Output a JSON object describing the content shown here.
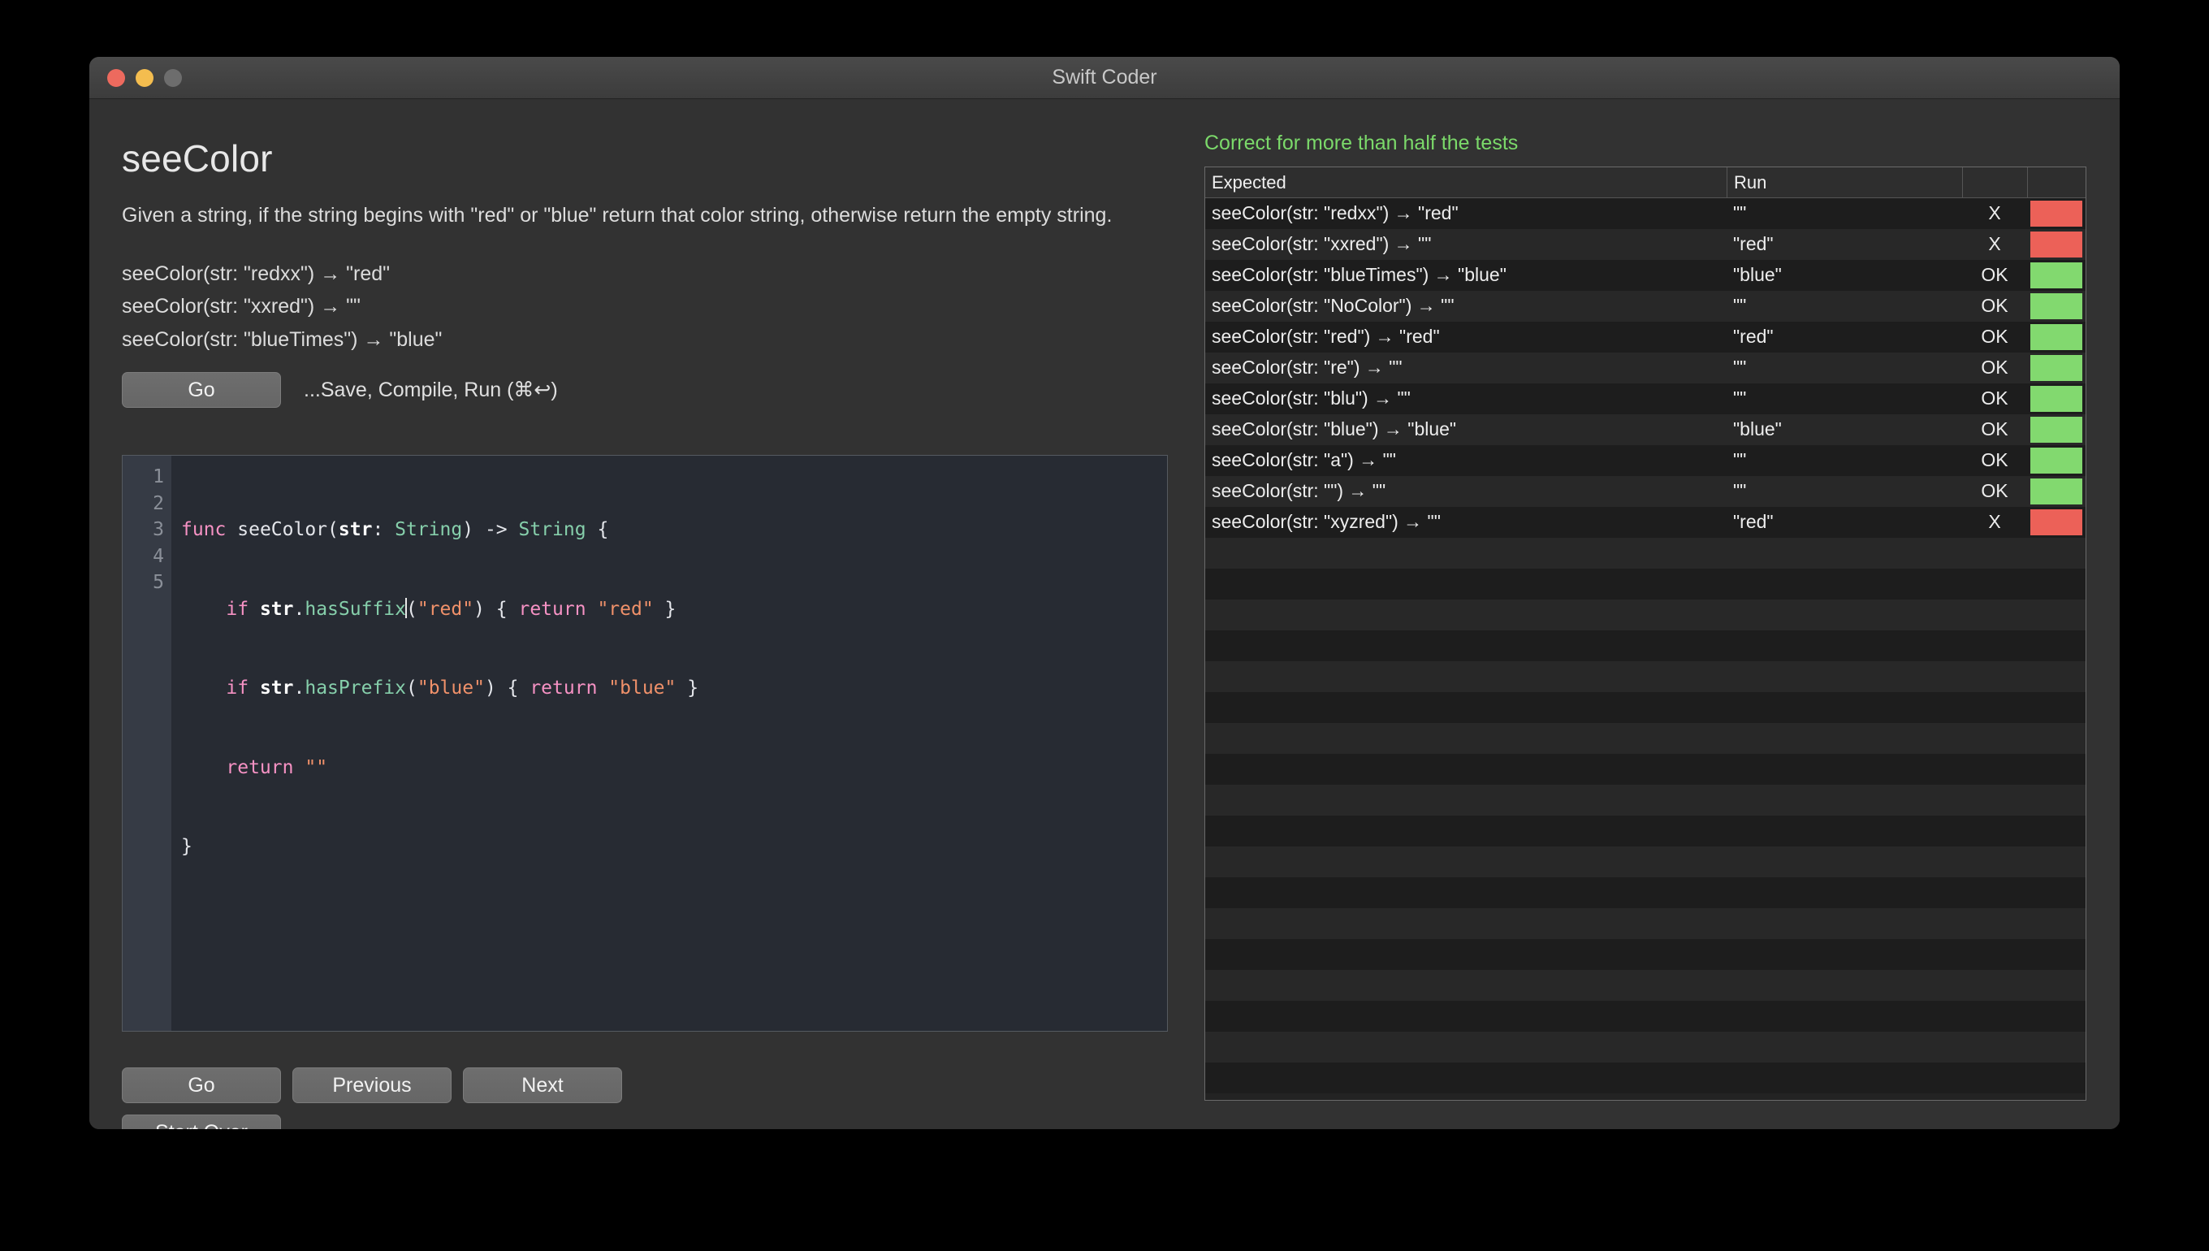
{
  "window": {
    "title": "Swift Coder",
    "traffic_lights": [
      "close-button",
      "minimize-button",
      "maximize-button"
    ]
  },
  "problem": {
    "title": "seeColor",
    "description": "Given a string, if the string begins with \"red\" or \"blue\" return that color string, otherwise return the empty string.",
    "examples": [
      "seeColor(str: \"redxx\") → \"red\"",
      "seeColor(str: \"xxred\") → \"\"",
      "seeColor(str: \"blueTimes\") → \"blue\""
    ]
  },
  "run_bar": {
    "go_label": "Go",
    "hint": "...Save, Compile, Run (⌘↩)"
  },
  "editor": {
    "line_numbers": [
      "1",
      "2",
      "3",
      "4",
      "5"
    ],
    "lines": [
      "func seeColor(str: String) -> String {",
      "    if str.hasSuffix(\"red\") { return \"red\" }",
      "    if str.hasPrefix(\"blue\") { return \"blue\" }",
      "    return \"\"",
      "}"
    ],
    "syntax_colors": {
      "keyword": "#f692c4",
      "type": "#86cfab",
      "string": "#f0916a",
      "plain": "#e4e6eb",
      "background": "#272b33",
      "gutter": "#363b45"
    }
  },
  "buttons": {
    "go": "Go",
    "previous": "Previous",
    "next": "Next",
    "start_over": "Start Over"
  },
  "results": {
    "status": "Correct for more than half the tests",
    "status_color": "#7bd96a",
    "headers": [
      "Expected",
      "Run",
      "",
      ""
    ],
    "pass_color": "#82d96f",
    "fail_color": "#ec6158",
    "rows": [
      {
        "expected": "seeColor(str: \"redxx\") → \"red\"",
        "run": "\"\"",
        "result": "X",
        "pass": false
      },
      {
        "expected": "seeColor(str: \"xxred\") → \"\"",
        "run": "\"red\"",
        "result": "X",
        "pass": false
      },
      {
        "expected": "seeColor(str: \"blueTimes\") → \"blue\"",
        "run": "\"blue\"",
        "result": "OK",
        "pass": true
      },
      {
        "expected": "seeColor(str: \"NoColor\") → \"\"",
        "run": "\"\"",
        "result": "OK",
        "pass": true
      },
      {
        "expected": "seeColor(str: \"red\") → \"red\"",
        "run": "\"red\"",
        "result": "OK",
        "pass": true
      },
      {
        "expected": "seeColor(str: \"re\") → \"\"",
        "run": "\"\"",
        "result": "OK",
        "pass": true
      },
      {
        "expected": "seeColor(str: \"blu\") → \"\"",
        "run": "\"\"",
        "result": "OK",
        "pass": true
      },
      {
        "expected": "seeColor(str: \"blue\") → \"blue\"",
        "run": "\"blue\"",
        "result": "OK",
        "pass": true
      },
      {
        "expected": "seeColor(str: \"a\") → \"\"",
        "run": "\"\"",
        "result": "OK",
        "pass": true
      },
      {
        "expected": "seeColor(str: \"\") → \"\"",
        "run": "\"\"",
        "result": "OK",
        "pass": true
      },
      {
        "expected": "seeColor(str: \"xyzred\") → \"\"",
        "run": "\"red\"",
        "result": "X",
        "pass": false
      }
    ]
  }
}
